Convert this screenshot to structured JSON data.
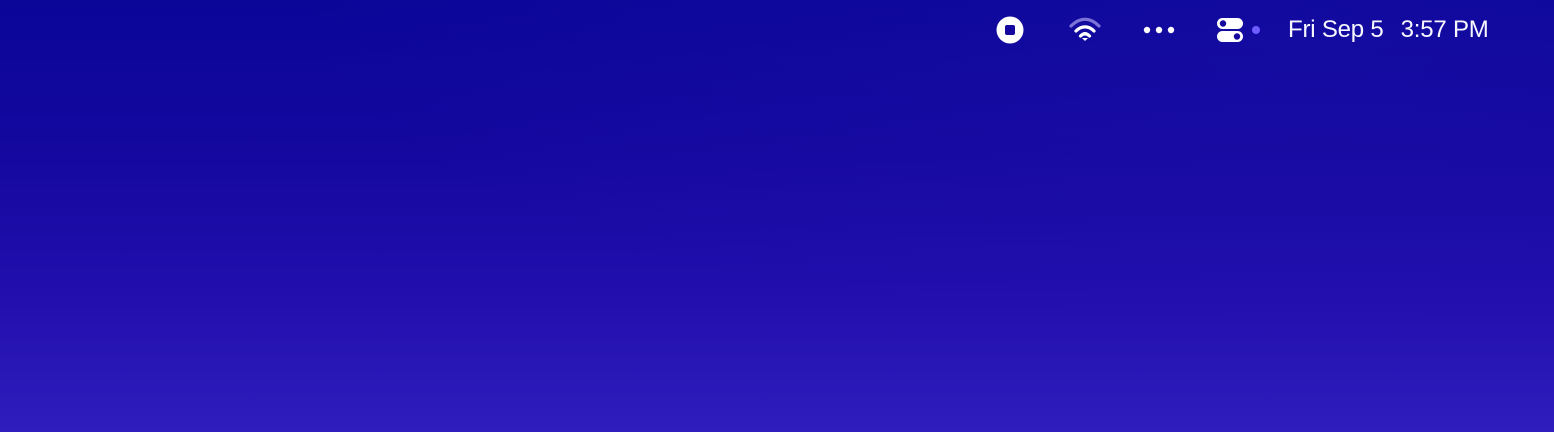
{
  "desktop": {
    "background_top": "#0b0598",
    "background_bottom": "#2f1dbd"
  },
  "menu_bar": {
    "status_items": [
      {
        "name": "screen-recording-stop",
        "icon": "stop-circle-icon"
      },
      {
        "name": "wifi",
        "icon": "wifi-icon"
      },
      {
        "name": "more-status-items",
        "icon": "ellipsis-icon"
      },
      {
        "name": "control-center",
        "icon": "control-center-icon",
        "indicator_color": "#6d5cff"
      }
    ],
    "clock": {
      "date": "Fri Sep 5",
      "time": "3:57 PM"
    }
  }
}
